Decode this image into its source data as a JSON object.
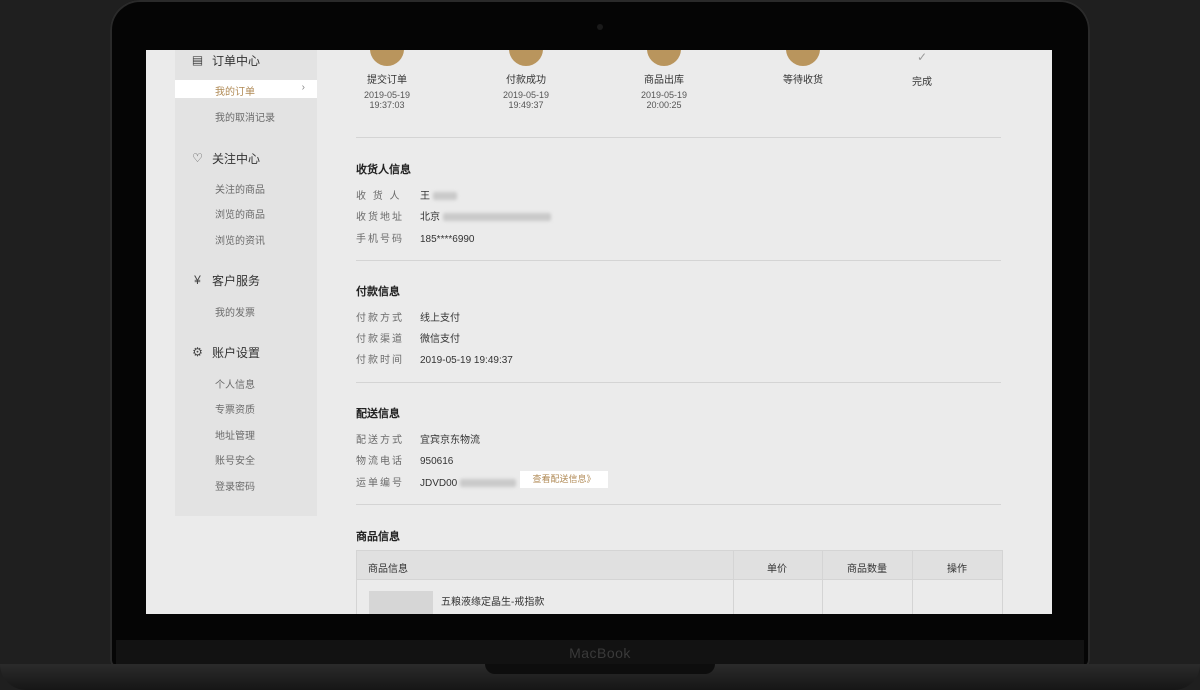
{
  "device": {
    "label": "MacBook"
  },
  "sidebar": {
    "sections": [
      {
        "title": "订单中心",
        "icon": "clipboard-icon"
      },
      {
        "title": "关注中心",
        "icon": "heart-icon"
      },
      {
        "title": "客户服务",
        "icon": "yen-icon"
      },
      {
        "title": "账户设置",
        "icon": "gear-icon"
      }
    ],
    "active_item": "我的订单",
    "items": {
      "cancel_records": "我的取消记录",
      "followed_products": "关注的商品",
      "browsed_products": "浏览的商品",
      "browsed_news": "浏览的资讯",
      "my_invoices": "我的发票",
      "personal_info": "个人信息",
      "special_invoice": "专票资质",
      "address_mgmt": "地址管理",
      "account_security": "账号安全",
      "login_password": "登录密码"
    }
  },
  "progress": [
    {
      "name": "提交订单",
      "date": "2019-05-19",
      "time": "19:37:03"
    },
    {
      "name": "付款成功",
      "date": "2019-05-19",
      "time": "19:49:37"
    },
    {
      "name": "商品出库",
      "date": "2019-05-19",
      "time": "20:00:25"
    },
    {
      "name": "等待收货",
      "date": "",
      "time": ""
    },
    {
      "name": "完成",
      "date": "",
      "time": ""
    }
  ],
  "consignee": {
    "title": "收货人信息",
    "name_label": "收 货 人",
    "name_value": "王",
    "address_label": "收货地址",
    "address_value": "北京",
    "phone_label": "手机号码",
    "phone_value": "185****6990"
  },
  "payment": {
    "title": "付款信息",
    "method_label": "付款方式",
    "method_value": "线上支付",
    "channel_label": "付款渠道",
    "channel_value": "微信支付",
    "time_label": "付款时间",
    "time_value": "2019-05-19 19:49:37"
  },
  "delivery": {
    "title": "配送信息",
    "method_label": "配送方式",
    "method_value": "宜宾京东物流",
    "phone_label": "物流电话",
    "phone_value": "950616",
    "tracking_label": "运单编号",
    "tracking_value": "JDVD00",
    "track_button": "查看配送信息》"
  },
  "products": {
    "title": "商品信息",
    "columns": [
      "商品信息",
      "单价",
      "商品数量",
      "操作"
    ],
    "rows": [
      {
        "name": "五粮液缘定晶生-戒指款"
      }
    ]
  }
}
